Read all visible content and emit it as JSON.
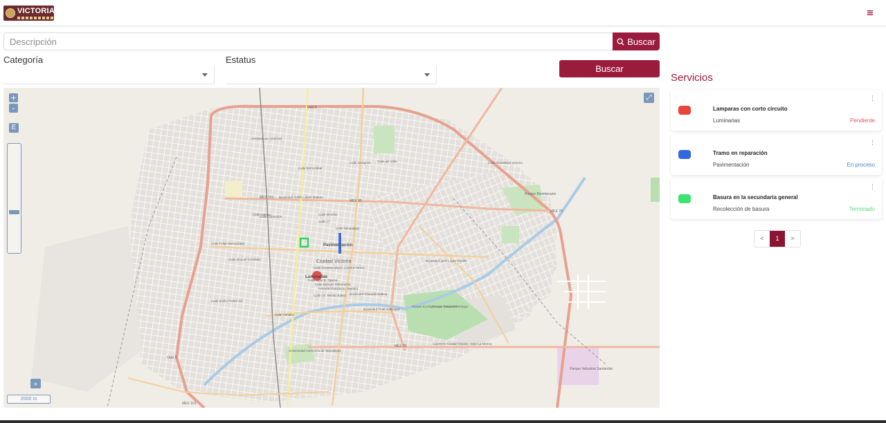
{
  "header": {
    "logo_text": "VICTORIA",
    "menu_icon": "hamburger-icon",
    "logo_icon": "city-seal-icon"
  },
  "search": {
    "placeholder": "Descripción",
    "value": "",
    "button_label": "Buscar",
    "button_icon": "search-icon"
  },
  "filters": {
    "categoria_label": "Categoría",
    "categoria_value": "",
    "estatus_label": "Estatus",
    "estatus_value": "",
    "button_label": "Buscar"
  },
  "map": {
    "zoom_in": "+",
    "zoom_out": "-",
    "extent_label": "E",
    "zoom_level": 0.37,
    "scale_text": "2000 m",
    "overview_icon": "double-chevron-right-icon",
    "fullscreen_icon": "expand-icon",
    "place_labels": {
      "city": "Ciudad Victoria",
      "markers": [
        "Pavimentación",
        "Luminarias"
      ],
      "parks": [
        "Parque Bicentenario",
        "Parque Ecológico Los Troncones",
        "Parque Estatal El Refugio",
        "Parque Industrial Santander",
        "Universidad Autónoma de Tamaulipas"
      ],
      "streets": [
        "Calle Morelos",
        "Calle 17",
        "Calle Tamaulipas",
        "Calle Hidalgo",
        "Boulevard Fidel Velázquez",
        "Avenida Francisco I. Madero",
        "Calle Felipe Berriozábal",
        "Calle Juan B. Tijerina",
        "Calle Mariano Matamoros",
        "Calle General Alberto Carrera Torres",
        "Calle Lic. Benito Juárez",
        "Calle Manuel González",
        "Calle Emilio Portes Gil",
        "Boulevard José López Portillo",
        "Calle del Valle",
        "Calle Berriozábal",
        "Boulevard Praxedis Balboa",
        "Carretera Ciudad Victoria - Soto La Marina",
        "Calle Comonfort",
        "Calle Canales",
        "Calle Zaragoza",
        "Boulevard Adolfo López Mateos",
        "Avenida Las Américas",
        "Calle Guadalupe Victoria"
      ],
      "highways": [
        "TAM 9",
        "MEX 101",
        "MEX 85",
        "MEX 70",
        "TAM 9",
        "MEX 101",
        "MEX 85"
      ]
    },
    "colors": {
      "marker_red": "#e53935",
      "marker_blue": "#3a6fd8",
      "marker_green": "#2fd35a"
    }
  },
  "servicios": {
    "title": "Servicios",
    "items": [
      {
        "title": "Lamparas con corto circuito",
        "category": "Luminarias",
        "status": "Pendiente",
        "status_color": "#e0575b",
        "color": "#e8443c"
      },
      {
        "title": "Tramo en reparación",
        "category": "Pavimentación",
        "status": "En proceso",
        "status_color": "#4a7fd4",
        "color": "#3268dd"
      },
      {
        "title": "Basura en la secundaria general",
        "category": "Recolección de basura",
        "status": "Terminado",
        "status_color": "#57d67a",
        "color": "#3ee26e"
      }
    ],
    "kebab_icon": "more-vertical-icon"
  },
  "pagination": {
    "prev": "<",
    "current": "1",
    "next": ">"
  }
}
